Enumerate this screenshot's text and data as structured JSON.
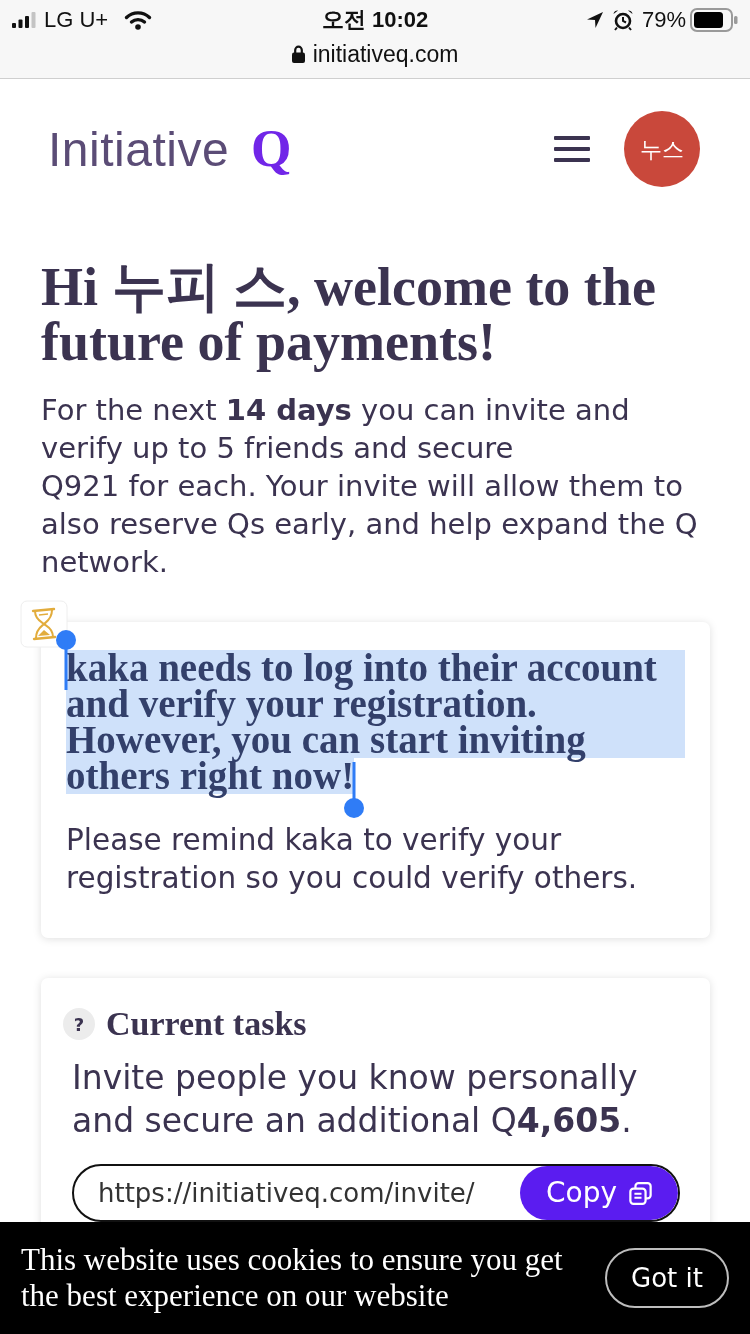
{
  "status_bar": {
    "carrier": "LG U+",
    "time": "오전 10:02",
    "battery": "79%",
    "url": "initiativeq.com"
  },
  "header": {
    "logo": {
      "word": "Initiative",
      "mark": "Q"
    },
    "avatar": "누스"
  },
  "welcome": {
    "heading": "Hi 누피 스, welcome to the future of payments!",
    "intro": "For the next **14 days** you can invite and verify up to 5 friends and secure\nQ921 for each. Your invite will allow them to also reserve Qs early, and help expand the Q network."
  },
  "notice": {
    "message": "kaka needs to log into their account and verify your registration. However, you can start inviting others right now!",
    "message_selected": true,
    "reminder": "Please remind kaka to verify your registration so you could verify others."
  },
  "tasks": {
    "help_icon": "?",
    "title": "Current tasks",
    "text": "Invite people you know personally and secure an additional Q**4,605**.",
    "invite_link": "https://initiativeq.com/invite/",
    "copy_button": "Copy"
  },
  "cookie_banner": {
    "text": "This website uses cookies to ensure you get the best experience on our website",
    "button": "Got it"
  }
}
